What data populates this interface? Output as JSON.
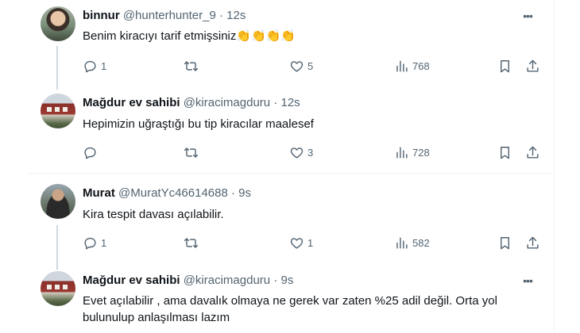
{
  "tweets": [
    {
      "name": "binnur",
      "handle": "@hunterhunter_9",
      "dot": "·",
      "time": "12s",
      "text": "Benim kiracıyı tarif etmişsiniz👏👏👏👏",
      "replies": "1",
      "retweets": "",
      "likes": "5",
      "views": "768"
    },
    {
      "name": "Mağdur ev sahibi",
      "handle": "@kiracimagduru",
      "dot": "·",
      "time": "12s",
      "text": "Hepimizin uğraştığı bu tip kiracılar maalesef",
      "replies": "",
      "retweets": "",
      "likes": "3",
      "views": "728"
    },
    {
      "name": "Murat",
      "handle": "@MuratYc46614688",
      "dot": "·",
      "time": "9s",
      "text": "Kira tespit davası açılabilir.",
      "replies": "1",
      "retweets": "",
      "likes": "1",
      "views": "582"
    },
    {
      "name": "Mağdur ev sahibi",
      "handle": "@kiracimagduru",
      "dot": "·",
      "time": "9s",
      "text": "Evet açılabilir , ama davalık olmaya ne gerek var zaten %25 adil değil. Orta yol bulunulup anlaşılması lazım"
    }
  ],
  "icons": {
    "more": "more-icon",
    "reply": "reply-icon",
    "retweet": "retweet-icon",
    "like": "heart-icon",
    "views": "views-icon",
    "bookmark": "bookmark-icon",
    "share": "share-icon"
  },
  "colors": {
    "text": "#0f1419",
    "secondary": "#536471",
    "thread_line": "#cfd9de",
    "divider": "#eff3f4"
  }
}
